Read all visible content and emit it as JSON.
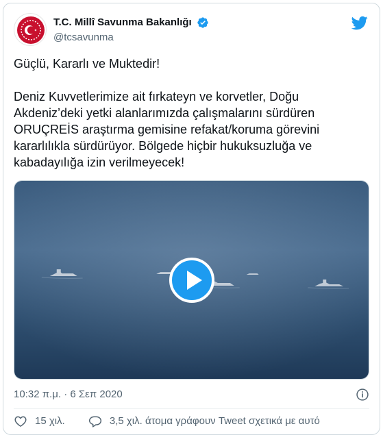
{
  "tweet": {
    "display_name": "T.C. Millî Savunma Bakanlığı",
    "handle": "@tcsavunma",
    "paragraphs": [
      "Güçlü, Kararlı ve Muktedir!",
      "Deniz Kuvvetlerimize ait fırkateyn ve korvetler, Doğu Akdeniz’deki yetki alanlarımızda çalışmalarını sürdüren ORUÇREİS araştırma gemisine refakat/koruma görevini kararlılıkla sürdürüyor. Bölgede hiçbir hukuksuzluğa ve kabadayılığa izin verilmeyecek!"
    ],
    "timestamp": "10:32 π.μ. · 6 Σεπ 2020",
    "likes": "15 χιλ.",
    "conversation": "3,5 χιλ. άτομα γράφουν Tweet σχετικά με αυτό"
  },
  "icons": {
    "verified": "verified-badge-icon",
    "bird": "twitter-bird-icon",
    "play": "play-icon",
    "info": "info-icon",
    "like": "heart-icon",
    "reply": "reply-bubble-icon"
  },
  "colors": {
    "accent": "#1d9bf0",
    "avatar_red": "#c8102e",
    "text": "#0f1419",
    "muted": "#536471"
  }
}
